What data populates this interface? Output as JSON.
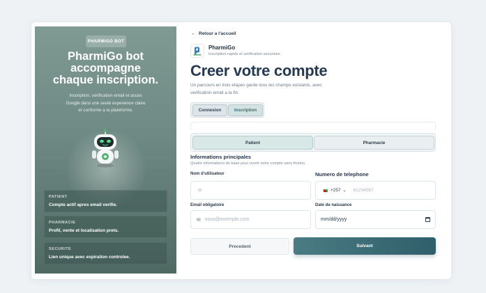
{
  "left_panel": {
    "badge": "PHARMIGO BOT",
    "title_line1": "PharmiGo bot",
    "title_line2": "accompagne",
    "title_line3": "chaque inscription.",
    "desc_line1": "Inscription, verification email et acces",
    "desc_line2": "Google dans une seule experience claire",
    "desc_line3": "et conforme a la plateforme.",
    "cards": [
      {
        "key": "PATIENT",
        "value": "Compte actif apres email verifie."
      },
      {
        "key": "PHARMACIE",
        "value": "Profil, vente et localisation prets."
      },
      {
        "key": "SECURITE",
        "value": "Lien unique avec expiration controlee."
      }
    ]
  },
  "header": {
    "back_label": "Retour a l'accueil",
    "brand_name": "PharmiGo",
    "brand_sub": "Inscription rapide et verification securisee.",
    "title": "Creer votre compte",
    "intro_line1": "Un parcours en trois etapes garde tous les champs existants, avec",
    "intro_line2": "verification email a la fin."
  },
  "auth_tabs": {
    "login": "Connexion",
    "signup": "Inscription"
  },
  "role_tabs": {
    "patient": "Patient",
    "pharmacy": "Pharmacie"
  },
  "section": {
    "title": "Informations principales",
    "subtitle": "Quatre informations de base pour ouvrir votre compte sans friction."
  },
  "form": {
    "username_label": "Nom d'utilisateur",
    "username_value": "",
    "phone_label": "Numero de telephone",
    "country_code": "+257",
    "phone_placeholder": "61234567",
    "email_label": "Email obligatoire",
    "email_placeholder": "vous@exemple.com",
    "birth_label": "Date de naissance",
    "birth_placeholder": "mm/dd/yyyy"
  },
  "actions": {
    "prev": "Precedent",
    "next": "Suivant"
  },
  "colors": {
    "accent": "#3f6f78",
    "panel": "#6e8983"
  }
}
